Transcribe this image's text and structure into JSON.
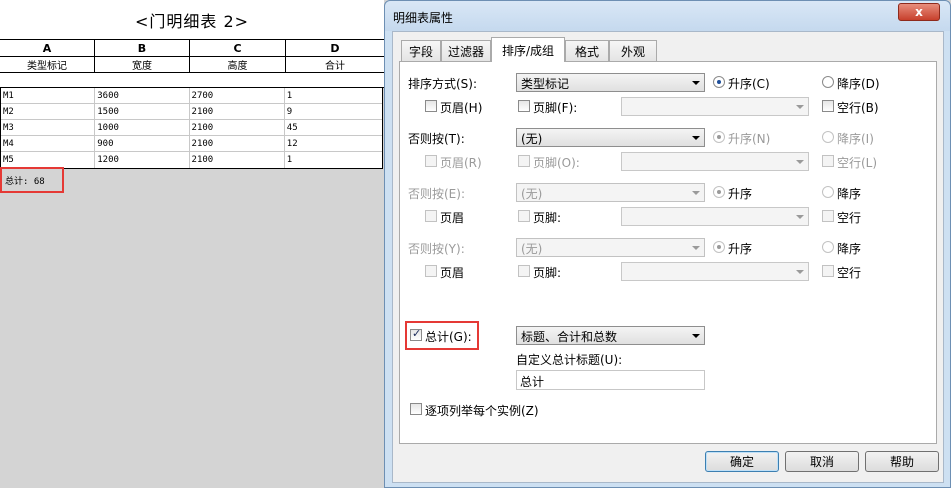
{
  "schedule": {
    "title": "<门明细表 2>",
    "column_letters": [
      "A",
      "B",
      "C",
      "D"
    ],
    "column_names": [
      "类型标记",
      "宽度",
      "高度",
      "合计"
    ],
    "rows": [
      [
        "M1",
        "3600",
        "2700",
        "1"
      ],
      [
        "M2",
        "1500",
        "2100",
        "9"
      ],
      [
        "M3",
        "1000",
        "2100",
        "45"
      ],
      [
        "M4",
        "900",
        "2100",
        "12"
      ],
      [
        "M5",
        "1200",
        "2100",
        "1"
      ]
    ],
    "grand_total": "总计: 68"
  },
  "dialog": {
    "title": "明细表属性",
    "close_glyph": "x",
    "tabs": [
      {
        "label": "字段"
      },
      {
        "label": "过滤器"
      },
      {
        "label": "排序/成组"
      },
      {
        "label": "格式"
      },
      {
        "label": "外观"
      }
    ],
    "sort_groups": [
      {
        "label": "排序方式(S):",
        "value": "类型标记",
        "asc": "升序(C)",
        "desc": "降序(D)",
        "header": "页眉(H)",
        "footer": "页脚(F):",
        "blank_line": "空行(B)"
      },
      {
        "label": "否则按(T):",
        "value": "(无)",
        "asc": "升序(N)",
        "desc": "降序(I)",
        "header": "页眉(R)",
        "footer": "页脚(O):",
        "blank_line": "空行(L)"
      },
      {
        "label": "否则按(E):",
        "value": "(无)",
        "asc": "升序",
        "desc": "降序",
        "header": "页眉",
        "footer": "页脚:",
        "blank_line": "空行"
      },
      {
        "label": "否则按(Y):",
        "value": "(无)",
        "asc": "升序",
        "desc": "降序",
        "header": "页眉",
        "footer": "页脚:",
        "blank_line": "空行"
      }
    ],
    "grand_total": {
      "label": "总计(G):",
      "checked": true,
      "option": "标题、合计和总数",
      "custom_title_label": "自定义总计标题(U):",
      "custom_title_value": "总计"
    },
    "itemize_label": "逐项列举每个实例(Z)",
    "buttons": {
      "ok": "确定",
      "cancel": "取消",
      "help": "帮助"
    }
  },
  "colors": {
    "highlight_box": "#e53935",
    "dialog_frame": "#cde0f2",
    "close_button": "#c7402c"
  }
}
